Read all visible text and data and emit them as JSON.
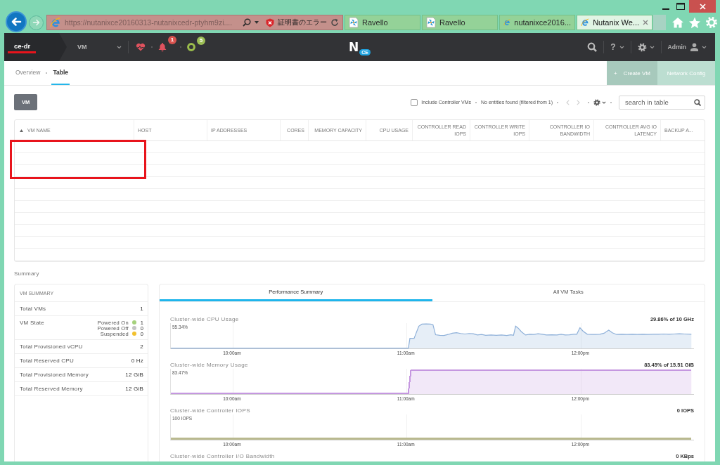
{
  "browser": {
    "address_bar": {
      "url": "https://nutanixce20160313-nutanixcedr-ptyhm9zi....",
      "certificate_error": "証明書のエラー"
    },
    "tabs": [
      {
        "label": "Ravello",
        "kind": "pinwheel",
        "selected": false
      },
      {
        "label": "Ravello",
        "kind": "pinwheel",
        "selected": false
      },
      {
        "label": "nutanixce2016...",
        "kind": "ie",
        "selected": false
      },
      {
        "label": "Nutanix We...",
        "kind": "ie",
        "selected": true
      }
    ]
  },
  "app_header": {
    "cluster": "ce-dr",
    "view": "VM",
    "alert_count": "1",
    "task_count": "5",
    "logo": "N",
    "logo_badge": "CE",
    "help": "?",
    "user": "Admin"
  },
  "page_tabs": [
    {
      "label": "Overview",
      "selected": false
    },
    {
      "label": "Table",
      "selected": true
    }
  ],
  "actions": [
    {
      "kind": "primary",
      "prefix": "+",
      "label": "Create VM"
    },
    {
      "kind": "secondary",
      "label": "Network Config"
    }
  ],
  "table_toolbar": {
    "entity_button": "VM",
    "include_controller_vms": {
      "label": "Include Controller VMs",
      "checked": false
    },
    "result": "No entities found (filtered from 1)",
    "pager_disabled": true,
    "search": {
      "placeholder": "search in table"
    }
  },
  "table": {
    "columns": [
      {
        "label": "VM NAME",
        "kind": "text",
        "sorted": true
      },
      {
        "label": "HOST",
        "kind": "text",
        "sorted": false
      },
      {
        "label": "IP ADDRESSES",
        "kind": "text",
        "sorted": false
      },
      {
        "label": "CORES",
        "kind": "number",
        "sorted": false
      },
      {
        "label": "MEMORY CAPACITY",
        "kind": "number",
        "sorted": false
      },
      {
        "label": "CPU USAGE",
        "kind": "number",
        "sorted": false
      },
      {
        "label": "CONTROLLER READ IOPS",
        "kind": "number",
        "sorted": false
      },
      {
        "label": "CONTROLLER WRITE IOPS",
        "kind": "number",
        "sorted": false
      },
      {
        "label": "CONTROLLER IO BANDWIDTH",
        "kind": "number",
        "sorted": false
      },
      {
        "label": "CONTROLLER AVG IO LATENCY",
        "kind": "number",
        "sorted": false
      },
      {
        "label": "BACKUP A...",
        "kind": "text",
        "sorted": false
      }
    ]
  },
  "summary": {
    "title": "Summary",
    "vm_summary": {
      "title": "VM SUMMARY",
      "rows": [
        {
          "kind": "value",
          "label": "Total VMs",
          "value": "1"
        },
        {
          "kind": "states",
          "label": "VM State",
          "states": [
            {
              "label": "Powered On",
              "color": "#a5d17c",
              "value": "1"
            },
            {
              "label": "Powered Off",
              "color": "#c4c4c4",
              "value": "0"
            },
            {
              "label": "Suspended",
              "color": "#f2c12e",
              "value": "0"
            }
          ]
        },
        {
          "kind": "value",
          "label": "Total Provisioned vCPU",
          "value": "2"
        },
        {
          "kind": "value",
          "label": "Total Reserved CPU",
          "value": "0 Hz"
        },
        {
          "kind": "value",
          "label": "Total Provisioned Memory",
          "value": "12 GiB"
        },
        {
          "kind": "value",
          "label": "Total Reserved Memory",
          "value": "12 GiB"
        }
      ]
    }
  },
  "performance": {
    "tabs": [
      {
        "label": "Performance Summary",
        "selected": true
      },
      {
        "label": "All VM Tasks",
        "selected": false
      }
    ],
    "charts": [
      {
        "title": "Cluster-wide CPU Usage",
        "value": "29.86% of 10 GHz",
        "kind": "spiky",
        "color": "#8eb0d9",
        "max_label": "55.34%",
        "x_labels": [
          "10:00am",
          "11:00am",
          "12:00pm"
        ]
      },
      {
        "title": "Cluster-wide Memory Usage",
        "value": "83.45% of 15.51 GiB",
        "kind": "step",
        "color": "#c597e0",
        "max_label": "83.47%",
        "x_labels": [
          "10:00am",
          "11:00am",
          "12:00pm"
        ]
      },
      {
        "title": "Cluster-wide Controller IOPS",
        "value": "0 IOPS",
        "kind": "flat",
        "color": "#b9b98f",
        "max_label": "100 IOPS",
        "x_labels": [
          "10:00am",
          "11:00am",
          "12:00pm"
        ]
      },
      {
        "title": "Cluster-wide Controller I/O Bandwidth",
        "value": "0 KBps"
      }
    ]
  },
  "annotations": {
    "cluster_underline": true,
    "table_highlight_box": true
  }
}
